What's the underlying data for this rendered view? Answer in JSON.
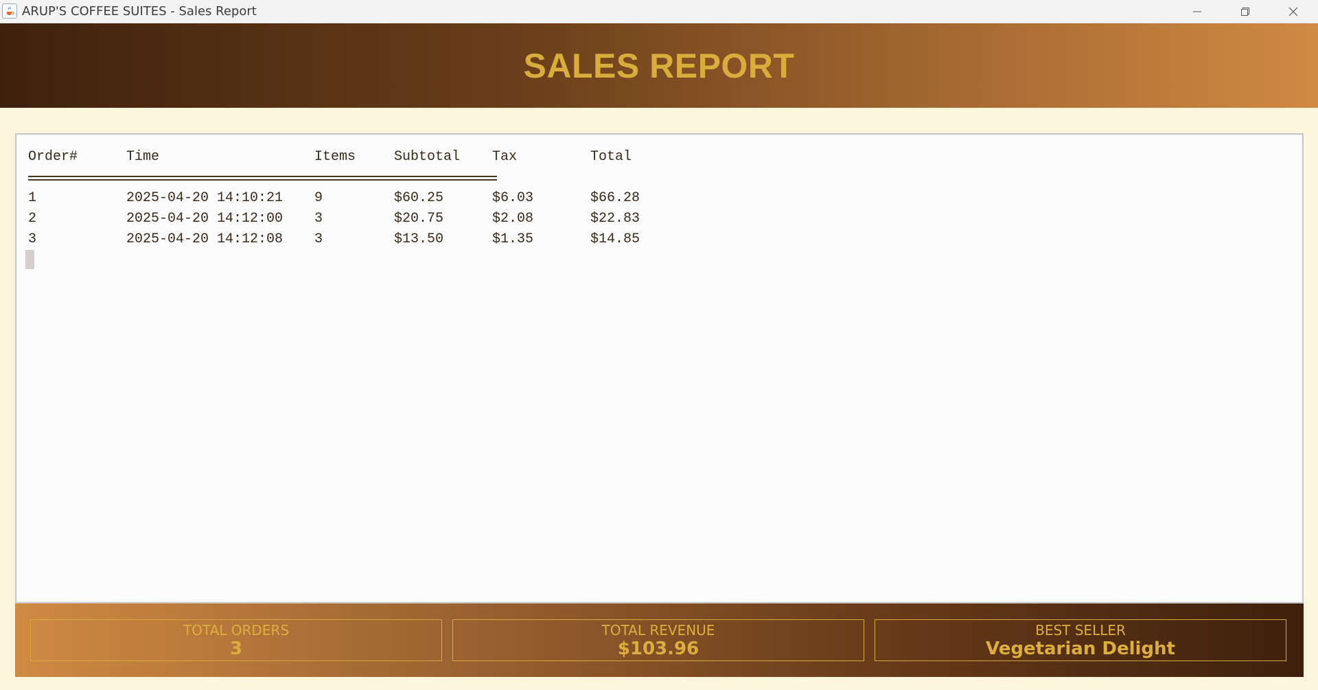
{
  "window": {
    "title": "ARUP'S COFFEE SUITES - Sales Report",
    "icon": "java-cup-icon"
  },
  "header": {
    "title": "SALES REPORT"
  },
  "report": {
    "columns": [
      "Order#",
      "Time",
      "Items",
      "Subtotal",
      "Tax",
      "Total"
    ],
    "rows": [
      {
        "order": "1",
        "time": "2025-04-20 14:10:21",
        "items": "9",
        "subtotal": "$60.25",
        "tax": "$6.03",
        "total": "$66.28"
      },
      {
        "order": "2",
        "time": "2025-04-20 14:12:00",
        "items": "3",
        "subtotal": "$20.75",
        "tax": "$2.08",
        "total": "$22.83"
      },
      {
        "order": "3",
        "time": "2025-04-20 14:12:08",
        "items": "3",
        "subtotal": "$13.50",
        "tax": "$1.35",
        "total": "$14.85"
      }
    ]
  },
  "summary": {
    "total_orders": {
      "label": "TOTAL ORDERS",
      "value": "3"
    },
    "total_revenue": {
      "label": "TOTAL REVENUE",
      "value": "$103.96"
    },
    "best_seller": {
      "label": "BEST SELLER",
      "value": "Vegetarian Delight"
    }
  },
  "colors": {
    "accent_gold": "#d9ad3b",
    "header_dark": "#3e210d",
    "header_light": "#cf8a43",
    "background": "#fdf6dd"
  }
}
